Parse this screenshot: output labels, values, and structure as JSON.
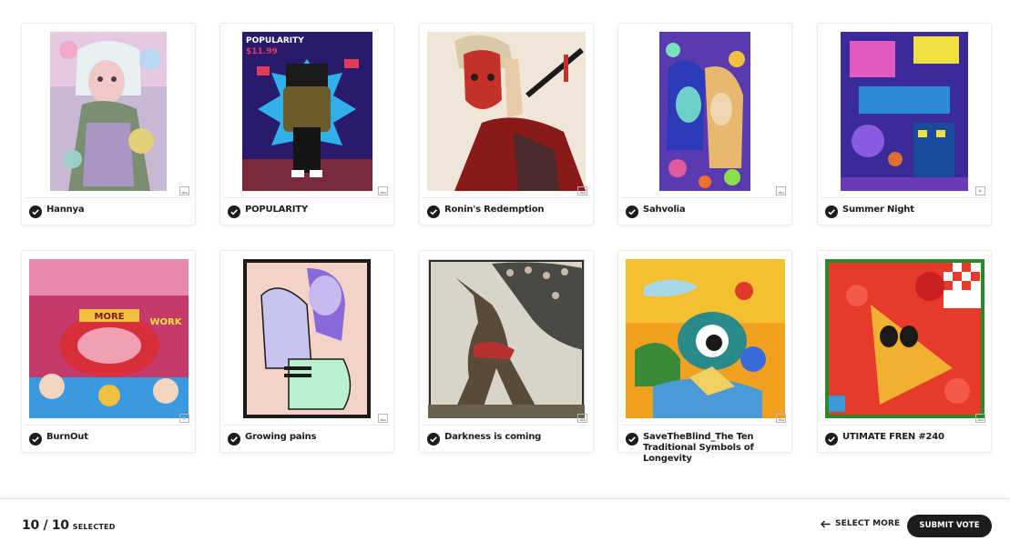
{
  "gallery": {
    "items": [
      {
        "title": "Hannya",
        "media": "image"
      },
      {
        "title": "POPULARITY",
        "media": "image"
      },
      {
        "title": "Ronin's Redemption",
        "media": "image"
      },
      {
        "title": "Sahvolia",
        "media": "image"
      },
      {
        "title": "Summer Night",
        "media": "video"
      },
      {
        "title": "BurnOut",
        "media": "video"
      },
      {
        "title": "Growing pains",
        "media": "image"
      },
      {
        "title": "Darkness is coming",
        "media": "image"
      },
      {
        "title": "SaveTheBlind_The Ten Traditional Symbols of Longevity",
        "media": "image"
      },
      {
        "title": "UTIMATE FREN #240",
        "media": "image"
      }
    ],
    "artwork_text": {
      "popularity_heading": "POPULARITY",
      "popularity_price": "$11.99",
      "burnout_sign": "MORE",
      "burnout_work": "WORK"
    }
  },
  "footer": {
    "count": "10 / 10",
    "count_label": "SELECTED",
    "select_more": "SELECT MORE",
    "submit": "SUBMIT VOTE"
  },
  "colors": {
    "text": "#1c1c1c",
    "button_bg": "#1c1c1c",
    "button_text": "#ffffff",
    "divider": "#e6e6e6"
  }
}
